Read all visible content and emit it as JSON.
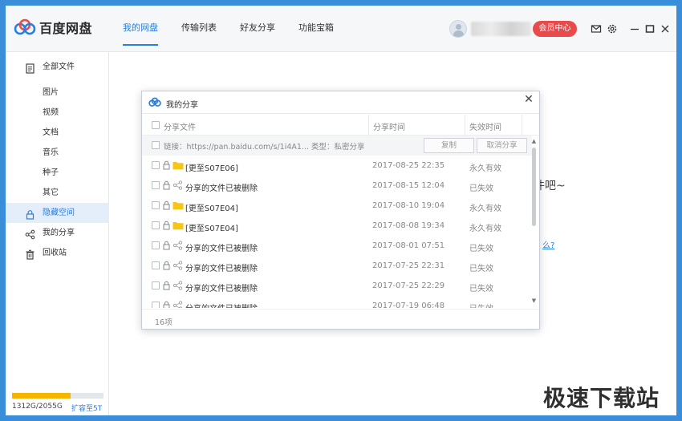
{
  "app": {
    "title": "百度网盘"
  },
  "header": {
    "tabs": [
      {
        "label": "我的网盘",
        "active": true
      },
      {
        "label": "传输列表",
        "active": false
      },
      {
        "label": "好友分享",
        "active": false
      },
      {
        "label": "功能宝箱",
        "active": false
      }
    ],
    "vip_label": "会员中心",
    "icons": [
      "mail-icon",
      "settings-icon",
      "minimize-icon",
      "maximize-icon",
      "close-icon"
    ]
  },
  "sidebar": {
    "items": [
      {
        "label": "全部文件",
        "icon": "file-icon"
      },
      {
        "label": "图片"
      },
      {
        "label": "视频"
      },
      {
        "label": "文档"
      },
      {
        "label": "音乐"
      },
      {
        "label": "种子"
      },
      {
        "label": "其它"
      },
      {
        "label": "隐藏空间",
        "icon": "lock-icon",
        "active": true
      },
      {
        "label": "我的分享",
        "icon": "share-icon"
      },
      {
        "label": "回收站",
        "icon": "trash-icon"
      }
    ],
    "quota": {
      "used_text": "1312G/2055G",
      "expand_label": "扩容至5T",
      "used_fraction": 0.638
    }
  },
  "background": {
    "partial_text": "件吧~",
    "partial_link": "么?"
  },
  "dialog": {
    "title": "我的分享",
    "columns": {
      "name": "分享文件",
      "time": "分享时间",
      "status": "失效时间"
    },
    "link_row": {
      "text": "链接：https://pan.baidu.com/s/1i4A1...   类型：私密分享",
      "copy_label": "复制",
      "cancel_label": "取消分享"
    },
    "rows": [
      {
        "name": "[更至S07E06]",
        "type": "folder",
        "time": "2017-08-25 22:35",
        "status": "永久有效"
      },
      {
        "name": "分享的文件已被删除",
        "type": "share",
        "time": "2017-08-15 12:04",
        "status": "已失效"
      },
      {
        "name": "[更至S07E04]",
        "type": "folder",
        "time": "2017-08-10 19:04",
        "status": "永久有效"
      },
      {
        "name": "[更至S07E04]",
        "type": "folder",
        "time": "2017-08-08 19:34",
        "status": "永久有效"
      },
      {
        "name": "分享的文件已被删除",
        "type": "share",
        "time": "2017-08-01 07:51",
        "status": "已失效"
      },
      {
        "name": "分享的文件已被删除",
        "type": "share",
        "time": "2017-07-25 22:31",
        "status": "已失效"
      },
      {
        "name": "分享的文件已被删除",
        "type": "share",
        "time": "2017-07-25 22:29",
        "status": "已失效"
      },
      {
        "name": "分享的文件已被删除",
        "type": "share",
        "time": "2017-07-19 06:48",
        "status": "已失效"
      }
    ],
    "count": "16项"
  },
  "watermark": "极速下载站",
  "colors": {
    "accent": "#2a7de1",
    "vip": "#e94a4a",
    "folder": "#f5c518",
    "quota": "#f5b400"
  }
}
